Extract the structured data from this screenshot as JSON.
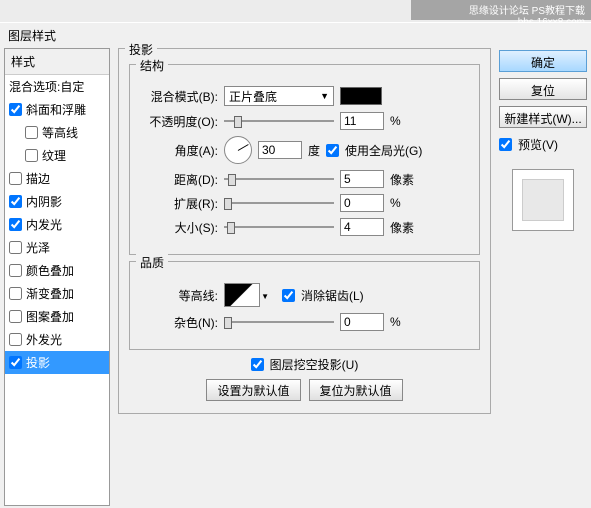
{
  "watermark": "思缘设计论坛   PS教程下载  bbs.16xx8.com",
  "dialog_title": "图层样式",
  "sidebar": {
    "header_label": "样式",
    "blend_label": "混合选项:自定",
    "items": [
      {
        "label": "斜面和浮雕",
        "checked": true,
        "indent": false
      },
      {
        "label": "等高线",
        "checked": false,
        "indent": true
      },
      {
        "label": "纹理",
        "checked": false,
        "indent": true
      },
      {
        "label": "描边",
        "checked": false,
        "indent": false
      },
      {
        "label": "内阴影",
        "checked": true,
        "indent": false
      },
      {
        "label": "内发光",
        "checked": true,
        "indent": false
      },
      {
        "label": "光泽",
        "checked": false,
        "indent": false
      },
      {
        "label": "颜色叠加",
        "checked": false,
        "indent": false
      },
      {
        "label": "渐变叠加",
        "checked": false,
        "indent": false
      },
      {
        "label": "图案叠加",
        "checked": false,
        "indent": false
      },
      {
        "label": "外发光",
        "checked": false,
        "indent": false
      },
      {
        "label": "投影",
        "checked": true,
        "indent": false,
        "selected": true
      }
    ]
  },
  "main": {
    "section_title": "投影",
    "structure_title": "结构",
    "blend_mode_label": "混合模式(B):",
    "blend_mode_value": "正片叠底",
    "opacity_label": "不透明度(O):",
    "opacity_value": "11",
    "opacity_unit": "%",
    "angle_label": "角度(A):",
    "angle_value": "30",
    "angle_unit": "度",
    "global_light_label": "使用全局光(G)",
    "distance_label": "距离(D):",
    "distance_value": "5",
    "distance_unit": "像素",
    "spread_label": "扩展(R):",
    "spread_value": "0",
    "spread_unit": "%",
    "size_label": "大小(S):",
    "size_value": "4",
    "size_unit": "像素",
    "quality_title": "品质",
    "contour_label": "等高线:",
    "antialias_label": "消除锯齿(L)",
    "noise_label": "杂色(N):",
    "noise_value": "0",
    "noise_unit": "%",
    "knockout_label": "图层挖空投影(U)",
    "default_set": "设置为默认值",
    "default_reset": "复位为默认值"
  },
  "right": {
    "ok": "确定",
    "reset": "复位",
    "new_style": "新建样式(W)...",
    "preview_label": "预览(V)"
  }
}
